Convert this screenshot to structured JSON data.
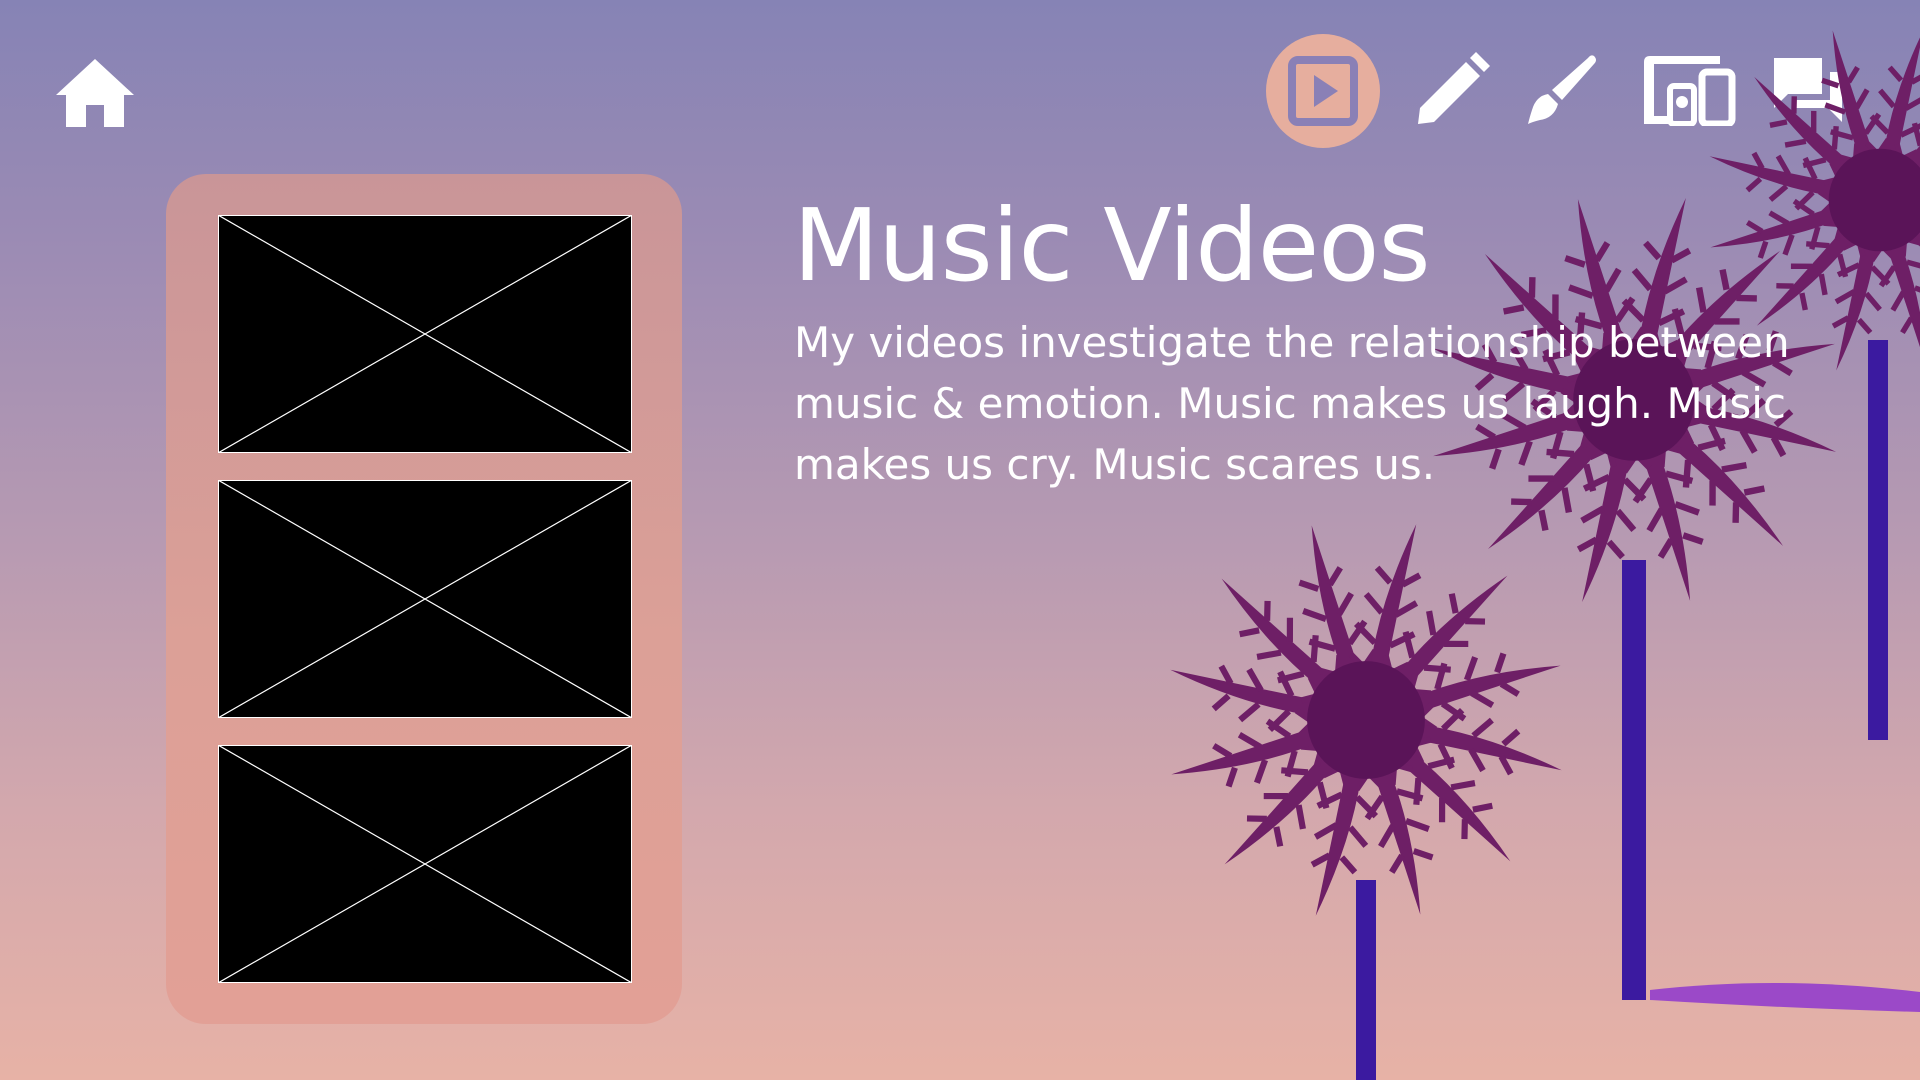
{
  "theme": {
    "gradient_top": "#8683b5",
    "gradient_bottom": "#e7b2a6",
    "accent": "#e6ae9e",
    "panel_color": "#dca097",
    "icon_color": "#ffffff",
    "active_icon_color": "#8a80b6",
    "palm_frond_color": "#6e1f66",
    "palm_trunk_color": "#3b1aa0"
  },
  "nav": {
    "home": {
      "icon": "home-icon"
    },
    "items": [
      {
        "icon": "play-video-icon",
        "active": true
      },
      {
        "icon": "pencil-icon",
        "active": false
      },
      {
        "icon": "paintbrush-icon",
        "active": false
      },
      {
        "icon": "devices-icon",
        "active": false
      },
      {
        "icon": "chat-bubbles-icon",
        "active": false
      }
    ]
  },
  "content": {
    "title": "Music Videos",
    "description": "My videos investigate the relationship between music & emotion. Music makes us laugh. Music makes us cry. Music scares us."
  },
  "gallery": {
    "videos": [
      {
        "icon": "video-placeholder"
      },
      {
        "icon": "video-placeholder"
      },
      {
        "icon": "video-placeholder"
      }
    ]
  }
}
